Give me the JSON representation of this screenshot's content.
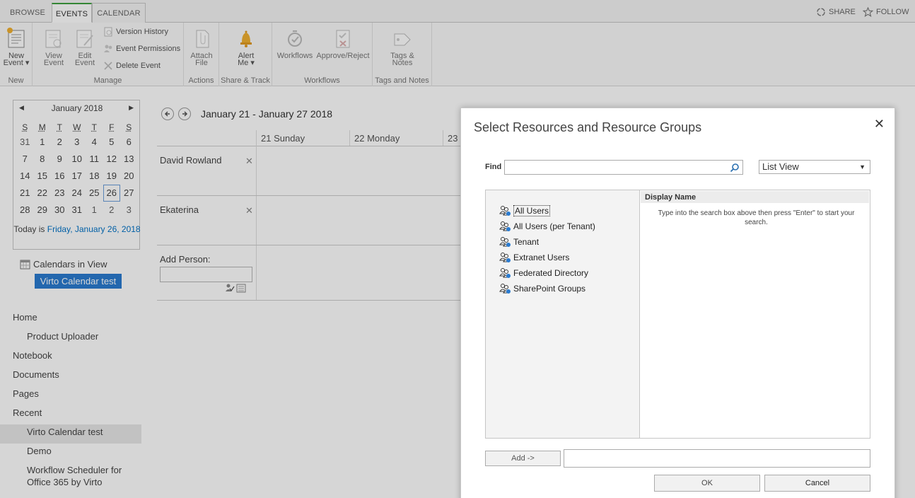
{
  "tabs": [
    {
      "label": "BROWSE"
    },
    {
      "label": "EVENTS"
    },
    {
      "label": "CALENDAR"
    }
  ],
  "top_actions": {
    "share": "SHARE",
    "follow": "FOLLOW"
  },
  "ribbon": {
    "new_event": {
      "line1": "New",
      "line2": "Event ▾"
    },
    "view_event": {
      "line1": "View",
      "line2": "Event"
    },
    "edit_event": {
      "line1": "Edit",
      "line2": "Event"
    },
    "version_history": "Version History",
    "event_permissions": "Event Permissions",
    "delete_event": "Delete Event",
    "attach_file": {
      "line1": "Attach",
      "line2": "File"
    },
    "alert_me": {
      "line1": "Alert",
      "line2": "Me ▾"
    },
    "workflows": "Workflows",
    "approve_reject": "Approve/Reject",
    "tags_notes": {
      "line1": "Tags &",
      "line2": "Notes"
    },
    "groups": {
      "new": "New",
      "manage": "Manage",
      "actions": "Actions",
      "share_track": "Share & Track",
      "workflows": "Workflows",
      "tags_notes": "Tags and Notes"
    }
  },
  "minicalendar": {
    "month": "January 2018",
    "prev": "◀",
    "next": "▶",
    "weekdays": [
      "S",
      "M",
      "T",
      "W",
      "T",
      "F",
      "S"
    ],
    "weeks": [
      [
        "31",
        "1",
        "2",
        "3",
        "4",
        "5",
        "6"
      ],
      [
        "7",
        "8",
        "9",
        "10",
        "11",
        "12",
        "13"
      ],
      [
        "14",
        "15",
        "16",
        "17",
        "18",
        "19",
        "20"
      ],
      [
        "21",
        "22",
        "23",
        "24",
        "25",
        "26",
        "27"
      ],
      [
        "28",
        "29",
        "30",
        "31",
        "1",
        "2",
        "3"
      ]
    ],
    "today_prefix": "Today is ",
    "today_link": "Friday, January 26, 2018"
  },
  "calendars_in_view": {
    "label": "Calendars in View",
    "item": "Virto Calendar test"
  },
  "nav": {
    "home": "Home",
    "product_uploader": "Product Uploader",
    "notebook": "Notebook",
    "documents": "Documents",
    "pages": "Pages",
    "recent": "Recent",
    "virto_calendar": "Virto Calendar test",
    "demo": "Demo",
    "workflow_scheduler": "Workflow Scheduler for Office 365 by Virto"
  },
  "schedule": {
    "range": "January 21 - January 27 2018",
    "days": [
      "21 Sunday",
      "22 Monday",
      "23"
    ],
    "people": [
      "David Rowland",
      "Ekaterina"
    ],
    "remove": "✕",
    "add_person": "Add Person:"
  },
  "dialog": {
    "title": "Select Resources and Resource Groups",
    "close": "✕",
    "find_label": "Find",
    "find_value": "",
    "view_mode": "List View",
    "tree": [
      "All Users",
      "All Users (per Tenant)",
      "Tenant",
      "Extranet Users",
      "Federated Directory",
      "SharePoint Groups"
    ],
    "results_header": "Display Name",
    "results_hint": "Type into the search box above then press \"Enter\" to start your search.",
    "add_button": "Add ->",
    "ok": "OK",
    "cancel": "Cancel"
  },
  "colors": {
    "accent": "#2a7bd0",
    "tab_active_top": "#3fa040",
    "link": "#0072c6"
  }
}
